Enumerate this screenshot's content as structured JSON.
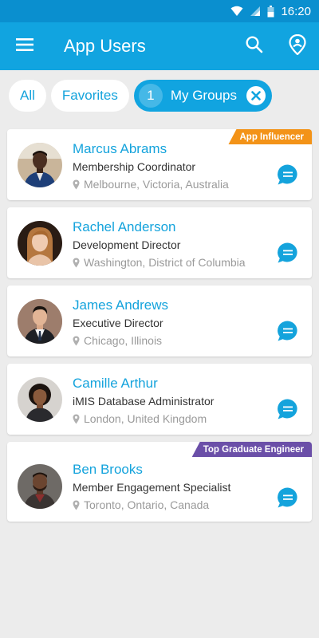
{
  "status_bar": {
    "time": "16:20",
    "icons": [
      "wifi-icon",
      "signal-icon",
      "battery-icon"
    ]
  },
  "app_bar": {
    "title": "App Users",
    "icons": [
      "menu-icon",
      "search-icon",
      "profile-location-icon"
    ]
  },
  "filters": {
    "all_label": "All",
    "favorites_label": "Favorites",
    "groups_count": "1",
    "groups_label": "My Groups"
  },
  "colors": {
    "primary": "#11a4e0",
    "status_bar": "#0a8fcf",
    "badge_orange": "#f39318",
    "badge_purple": "#6b4fa8"
  },
  "users": [
    {
      "name": "Marcus Abrams",
      "role": "Membership Coordinator",
      "location": "Melbourne, Victoria, Australia",
      "badge": "App Influencer"
    },
    {
      "name": "Rachel Anderson",
      "role": "Development Director",
      "location": "Washington, District of Columbia",
      "badge": ""
    },
    {
      "name": "James Andrews",
      "role": "Executive Director",
      "location": "Chicago, Illinois",
      "badge": ""
    },
    {
      "name": "Camille Arthur",
      "role": "iMIS Database Administrator",
      "location": "London, United Kingdom",
      "badge": ""
    },
    {
      "name": "Ben Brooks",
      "role": "Member Engagement Specialist",
      "location": "Toronto, Ontario, Canada",
      "badge": "Top Graduate Engineer"
    }
  ]
}
